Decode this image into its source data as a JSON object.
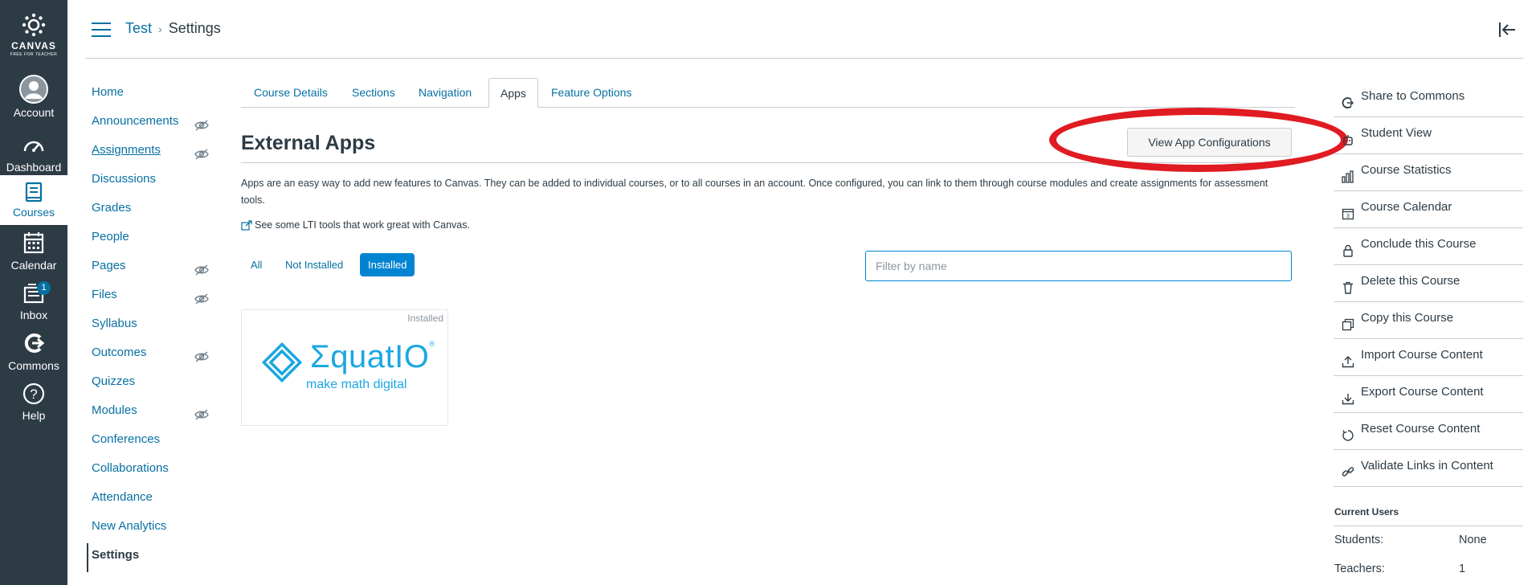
{
  "global_nav": {
    "logo_word": "CANVAS",
    "logo_sub": "FREE FOR TEACHER",
    "items": [
      {
        "label": "Account",
        "icon": "account-avatar-icon"
      },
      {
        "label": "Dashboard",
        "icon": "dashboard-icon"
      },
      {
        "label": "Courses",
        "icon": "courses-icon",
        "active": true
      },
      {
        "label": "Calendar",
        "icon": "calendar-icon"
      },
      {
        "label": "Inbox",
        "icon": "inbox-icon",
        "badge": "1"
      },
      {
        "label": "Commons",
        "icon": "commons-icon"
      },
      {
        "label": "Help",
        "icon": "help-icon"
      }
    ]
  },
  "header": {
    "breadcrumb": [
      "Test",
      "Settings"
    ]
  },
  "course_nav": [
    {
      "label": "Home"
    },
    {
      "label": "Announcements",
      "hidden": true
    },
    {
      "label": "Assignments",
      "hidden": true
    },
    {
      "label": "Discussions"
    },
    {
      "label": "Grades"
    },
    {
      "label": "People"
    },
    {
      "label": "Pages",
      "hidden": true
    },
    {
      "label": "Files",
      "hidden": true
    },
    {
      "label": "Syllabus"
    },
    {
      "label": "Outcomes",
      "hidden": true
    },
    {
      "label": "Quizzes"
    },
    {
      "label": "Modules",
      "hidden": true
    },
    {
      "label": "Conferences"
    },
    {
      "label": "Collaborations"
    },
    {
      "label": "Attendance"
    },
    {
      "label": "New Analytics"
    },
    {
      "label": "Settings",
      "active": true
    }
  ],
  "tabs": [
    "Course Details",
    "Sections",
    "Navigation",
    "Apps",
    "Feature Options"
  ],
  "active_tab": "Apps",
  "main": {
    "title": "External Apps",
    "view_button": "View App Configurations",
    "description": "Apps are an easy way to add new features to Canvas. They can be added to individual courses, or to all courses in an account. Once configured, you can link to them through course modules and create assignments for assessment tools.",
    "lti_link": "See some LTI tools that work great with Canvas.",
    "filters": [
      "All",
      "Not Installed",
      "Installed"
    ],
    "active_filter": "Installed",
    "filter_placeholder": "Filter by name",
    "app": {
      "status": "Installed",
      "name": "ΣquatIO",
      "reg_mark": "®",
      "tagline": "make math digital"
    }
  },
  "right_sidebar": {
    "items": [
      {
        "label": "Share to Commons",
        "icon": "share-icon"
      },
      {
        "label": "Student View",
        "icon": "student-view-icon"
      },
      {
        "label": "Course Statistics",
        "icon": "statistics-icon"
      },
      {
        "label": "Course Calendar",
        "icon": "calendar-icon"
      },
      {
        "label": "Conclude this Course",
        "icon": "lock-icon"
      },
      {
        "label": "Delete this Course",
        "icon": "trash-icon"
      },
      {
        "label": "Copy this Course",
        "icon": "copy-icon"
      },
      {
        "label": "Import Course Content",
        "icon": "upload-icon"
      },
      {
        "label": "Export Course Content",
        "icon": "download-icon"
      },
      {
        "label": "Reset Course Content",
        "icon": "reset-icon"
      },
      {
        "label": "Validate Links in Content",
        "icon": "link-icon"
      }
    ],
    "current_users": {
      "title": "Current Users",
      "rows": [
        {
          "label": "Students:",
          "value": "None"
        },
        {
          "label": "Teachers:",
          "value": "1"
        }
      ]
    }
  },
  "colors": {
    "nav_bg": "#2d3b45",
    "link": "#0770a3",
    "accent": "#0084d1",
    "annotation_red": "#e01b22",
    "app_brand": "#1ba7e1"
  }
}
